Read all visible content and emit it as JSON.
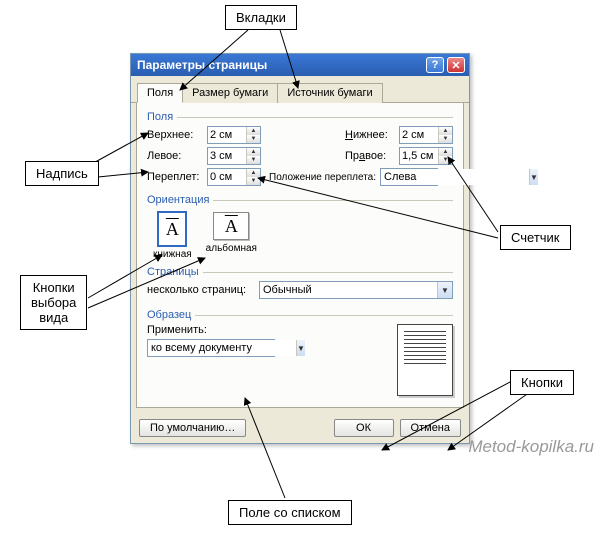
{
  "callouts": {
    "tabs": "Вкладки",
    "label": "Надпись",
    "spin": "Счетчик",
    "radio": "Кнопки\nвыбора\nвида",
    "buttons": "Кнопки",
    "combo": "Поле со списком"
  },
  "dialog": {
    "title": "Параметры страницы",
    "tabs": [
      "Поля",
      "Размер бумаги",
      "Источник бумаги"
    ],
    "margins": {
      "group": "Поля",
      "top_label": "Верхнее:",
      "top_value": "2 см",
      "bottom_label": "Нижнее:",
      "bottom_value": "2 см",
      "left_label": "Левое:",
      "left_value": "3 см",
      "right_label": "Правое:",
      "right_value": "1,5 см",
      "gutter_label": "Переплет:",
      "gutter_value": "0 см",
      "gutter_pos_label": "Положение переплета:",
      "gutter_pos_value": "Слева"
    },
    "orientation": {
      "group": "Ориентация",
      "portrait": "книжная",
      "landscape": "альбомная"
    },
    "pages": {
      "group": "Страницы",
      "multi_label": "несколько страниц:",
      "multi_value": "Обычный"
    },
    "preview": {
      "group": "Образец",
      "apply_label": "Применить:",
      "apply_value": "ко всему документу"
    },
    "buttons": {
      "default": "По умолчанию…",
      "ok": "ОК",
      "cancel": "Отмена"
    }
  },
  "watermark": "Metod-kopilka.ru"
}
